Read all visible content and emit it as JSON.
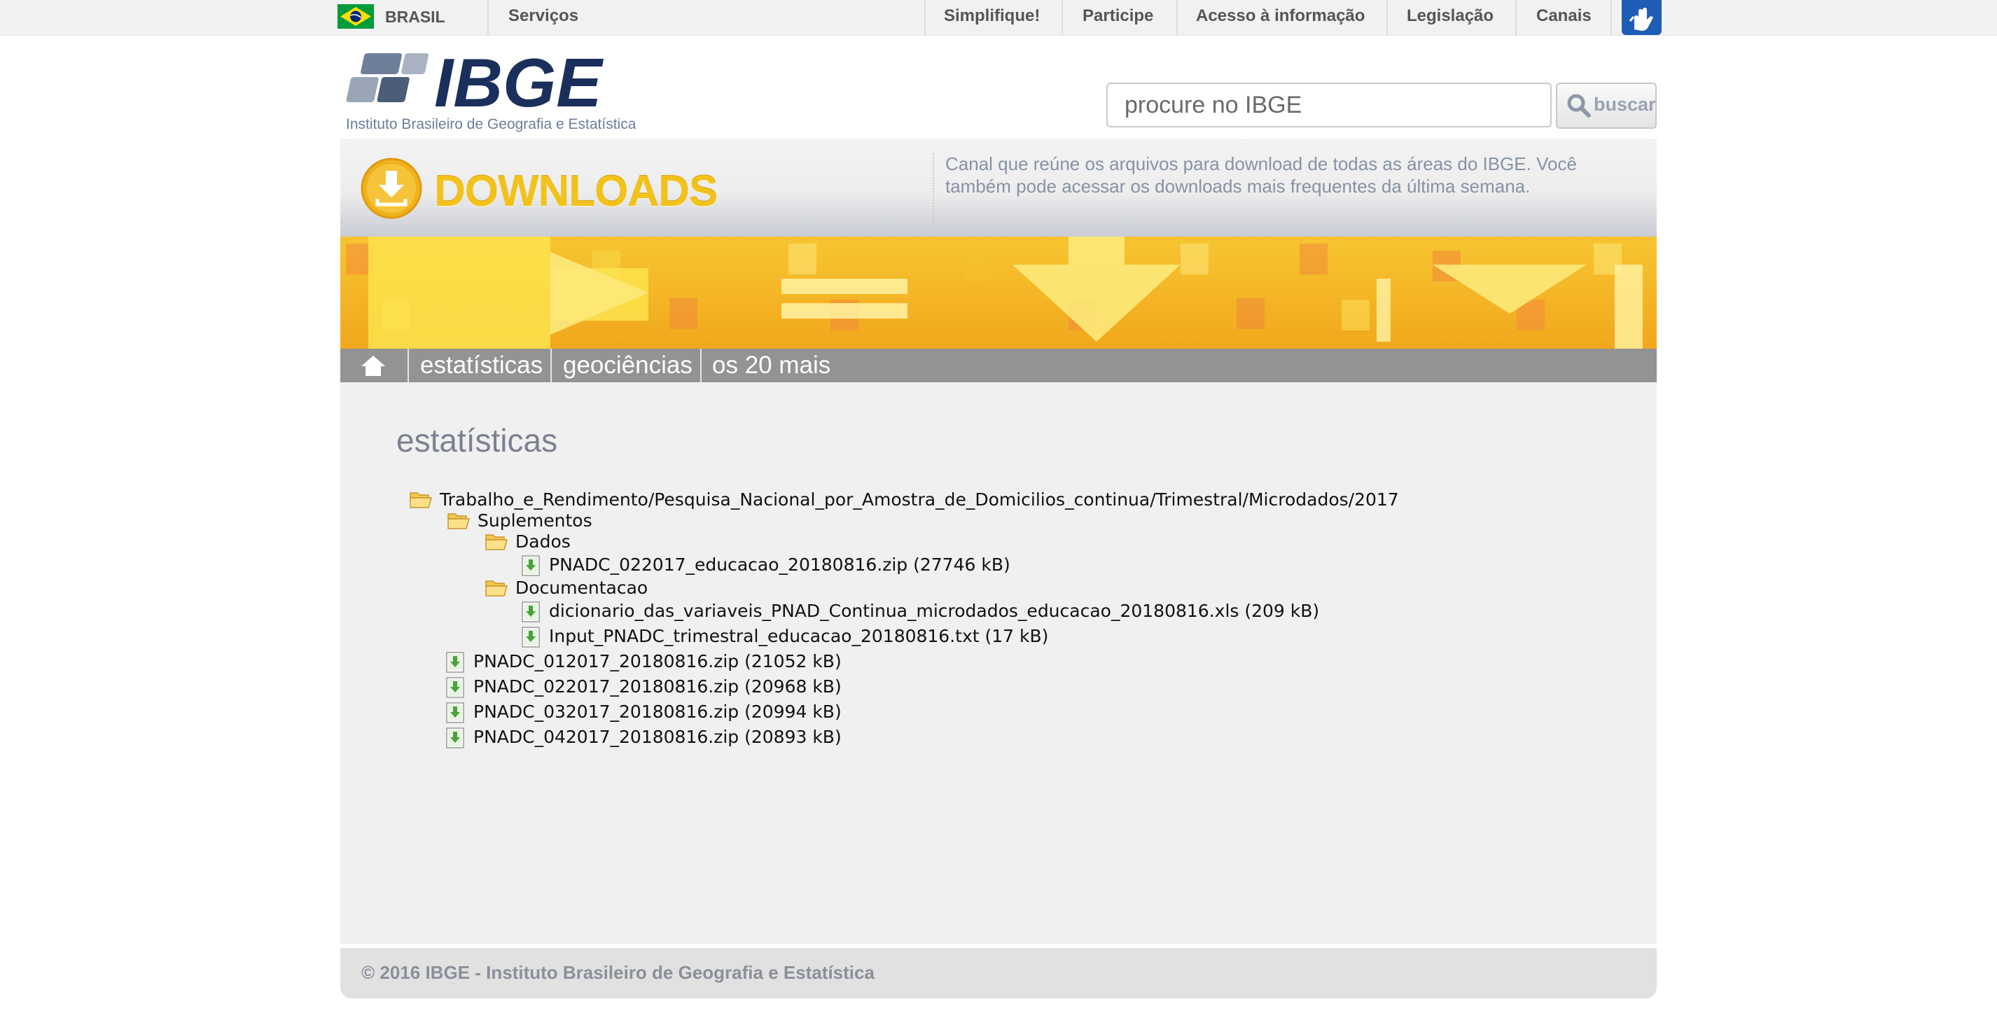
{
  "gov_bar": {
    "country": "BRASIL",
    "services": "Serviços",
    "links": [
      "Simplifique!",
      "Participe",
      "Acesso à informação",
      "Legislação",
      "Canais"
    ],
    "flag_colors": [
      "#009b3a",
      "#fedf00",
      "#002776"
    ],
    "libras_icon": "accessibility-hands-icon"
  },
  "header": {
    "logo_text": "IBGE",
    "logo_subtitle": "Instituto Brasileiro de Geografia e Estatística",
    "search": {
      "placeholder": "procure no IBGE",
      "button_label": "buscar",
      "icon": "magnifier-icon"
    }
  },
  "downloads": {
    "title": "DOWNLOADS",
    "description": "Canal que reúne os arquivos para download de todas as áreas do IBGE. Você também pode acessar os downloads mais frequentes da última semana.",
    "accent_color": "#f2c21c"
  },
  "nav": {
    "home_icon": "home-icon",
    "items": [
      "estatísticas",
      "geociências",
      "os 20 mais"
    ]
  },
  "main": {
    "section_title": "estatísticas",
    "tree": [
      {
        "type": "folder",
        "level": 0,
        "label": "Trabalho_e_Rendimento/Pesquisa_Nacional_por_Amostra_de_Domicilios_continua/Trimestral/Microdados/2017"
      },
      {
        "type": "folder",
        "level": 1,
        "label": "Suplementos"
      },
      {
        "type": "folder",
        "level": 2,
        "label": "Dados"
      },
      {
        "type": "file",
        "level": 3,
        "label": "PNADC_022017_educacao_20180816.zip (27746 kB)"
      },
      {
        "type": "folder",
        "level": 2,
        "label": "Documentacao"
      },
      {
        "type": "file",
        "level": 3,
        "label": "dicionario_das_variaveis_PNAD_Continua_microdados_educacao_20180816.xls (209 kB)"
      },
      {
        "type": "file",
        "level": 3,
        "label": "Input_PNADC_trimestral_educacao_20180816.txt (17 kB)"
      },
      {
        "type": "file",
        "level": 1,
        "label": "PNADC_012017_20180816.zip (21052 kB)"
      },
      {
        "type": "file",
        "level": 1,
        "label": "PNADC_022017_20180816.zip (20968 kB)"
      },
      {
        "type": "file",
        "level": 1,
        "label": "PNADC_032017_20180816.zip (20994 kB)"
      },
      {
        "type": "file",
        "level": 1,
        "label": "PNADC_042017_20180816.zip (20893 kB)"
      }
    ]
  },
  "footer": {
    "text": "© 2016 IBGE - Instituto Brasileiro de Geografia e Estatística"
  }
}
